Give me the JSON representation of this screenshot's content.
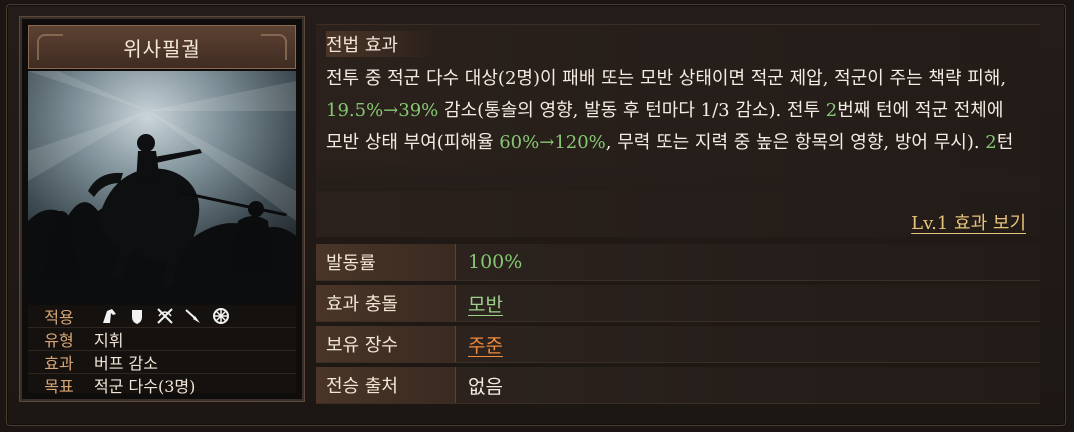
{
  "card": {
    "title": "위사필궐",
    "stats": [
      {
        "key": "적용",
        "icons": [
          "horse-icon",
          "shield-icon",
          "crossbow-icon",
          "spear-icon",
          "wheel-icon"
        ]
      },
      {
        "key": "유형",
        "value": "지휘"
      },
      {
        "key": "효과",
        "value": "버프 감소"
      },
      {
        "key": "목표",
        "value": "적군 다수(3명)"
      }
    ]
  },
  "description": {
    "heading": "전법 효과",
    "segments": [
      {
        "t": "전투 중 적군 다수 대상(2명)이 패배 또는 모반 상태이면 적군 제압, 적군이 주는 책략 피해, "
      },
      {
        "t": "19.5%→39%",
        "green": true
      },
      {
        "t": " 감소(통솔의 영향, 발동 후 턴마다 1/3 감소). 전투 "
      },
      {
        "t": "2",
        "green": true
      },
      {
        "t": "번째 턴에 적군 전체에 모반 상태 부여(피해율 "
      },
      {
        "t": "60%→120%",
        "green": true
      },
      {
        "t": ", 무력 또는 지력 중 높은 항목의 영향, 방어 무시). "
      },
      {
        "t": "2",
        "green": true
      },
      {
        "t": "턴"
      }
    ],
    "level_link": "Lv.1 효과 보기"
  },
  "rows": [
    {
      "label": "발동률",
      "value": "100%",
      "style": "green"
    },
    {
      "label": "효과 충돌",
      "value": "모반",
      "style": "link-green"
    },
    {
      "label": "보유 장수",
      "value": "주준",
      "style": "link-orange"
    },
    {
      "label": "전승 출처",
      "value": "없음",
      "style": "plain"
    }
  ],
  "colors": {
    "accent_green": "#86c872",
    "accent_orange": "#f08a3c",
    "gold": "#e6c27a"
  }
}
